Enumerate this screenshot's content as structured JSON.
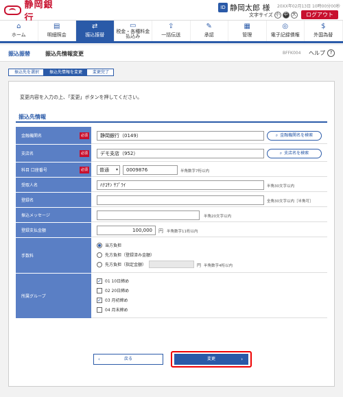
{
  "header": {
    "bank_name": "静岡銀行",
    "user_name": "静岡太郎 様",
    "login_time": "20XX年02月13日 10時00分00秒",
    "font_size_label": "文字サイズ",
    "font_sizes": [
      "小",
      "中",
      "大"
    ],
    "logout": "ログアウト"
  },
  "nav": [
    {
      "label": "ホーム",
      "icon": "home-icon"
    },
    {
      "label": "明細照会",
      "icon": "document-icon"
    },
    {
      "label": "振込振替",
      "icon": "transfer-icon"
    },
    {
      "label": "税金・各種料金",
      "label2": "払込み",
      "icon": "tax-icon"
    },
    {
      "label": "一括伝送",
      "icon": "upload-icon"
    },
    {
      "label": "承認",
      "icon": "approve-icon"
    },
    {
      "label": "管理",
      "icon": "manage-icon"
    },
    {
      "label": "電子記録債権",
      "icon": "ecredit-icon"
    },
    {
      "label": "外国為替",
      "icon": "forex-icon"
    }
  ],
  "titlebar": {
    "category": "振込振替",
    "title": "振込先情報変更",
    "code": "BFFK004",
    "help": "ヘルプ"
  },
  "steps": [
    "振込先を選択",
    "振込先情報を変更",
    "変更完了"
  ],
  "instruction": "変更内容を入力の上、「変更」ボタンを押してください。",
  "section_title": "振込先情報",
  "required_badge": "必須",
  "form": {
    "bank": {
      "label": "金融機関名",
      "value": "静岡銀行（0149）",
      "search": "金融機関名を検索"
    },
    "branch": {
      "label": "支店名",
      "value": "デモ支店（952）",
      "search": "支店名を検索"
    },
    "account": {
      "label": "科目 口座番号",
      "type": "普通",
      "number": "0009876",
      "note": "半角数字7桁以内"
    },
    "recipient": {
      "label": "受取人名",
      "value": "ﾊﾅｺｻﾝ ｻﾌﾟﾗｲ",
      "note": "半角30文字以内"
    },
    "nickname": {
      "label": "登録名",
      "value": "",
      "note": "全角30文字以内［半角可］"
    },
    "message": {
      "label": "振込メッセージ",
      "value": "",
      "note": "半角20文字以内"
    },
    "amount": {
      "label": "登録支払金額",
      "value": "100,000",
      "unit": "円",
      "note": "半角数字11桁以内"
    },
    "fee": {
      "label": "手数料",
      "options": [
        "当方負担",
        "先方負担（登録済み金額）",
        "先方負担（指定金額）"
      ],
      "selected": 0,
      "unit": "円",
      "note": "半角数字4桁以内"
    },
    "group": {
      "label": "所属グループ",
      "items": [
        {
          "label": "01 10日締め",
          "checked": true
        },
        {
          "label": "02 20日締め",
          "checked": false
        },
        {
          "label": "03 月初締め",
          "checked": true
        },
        {
          "label": "04 月末締め",
          "checked": false
        }
      ]
    }
  },
  "buttons": {
    "back": "戻る",
    "change": "変更"
  }
}
